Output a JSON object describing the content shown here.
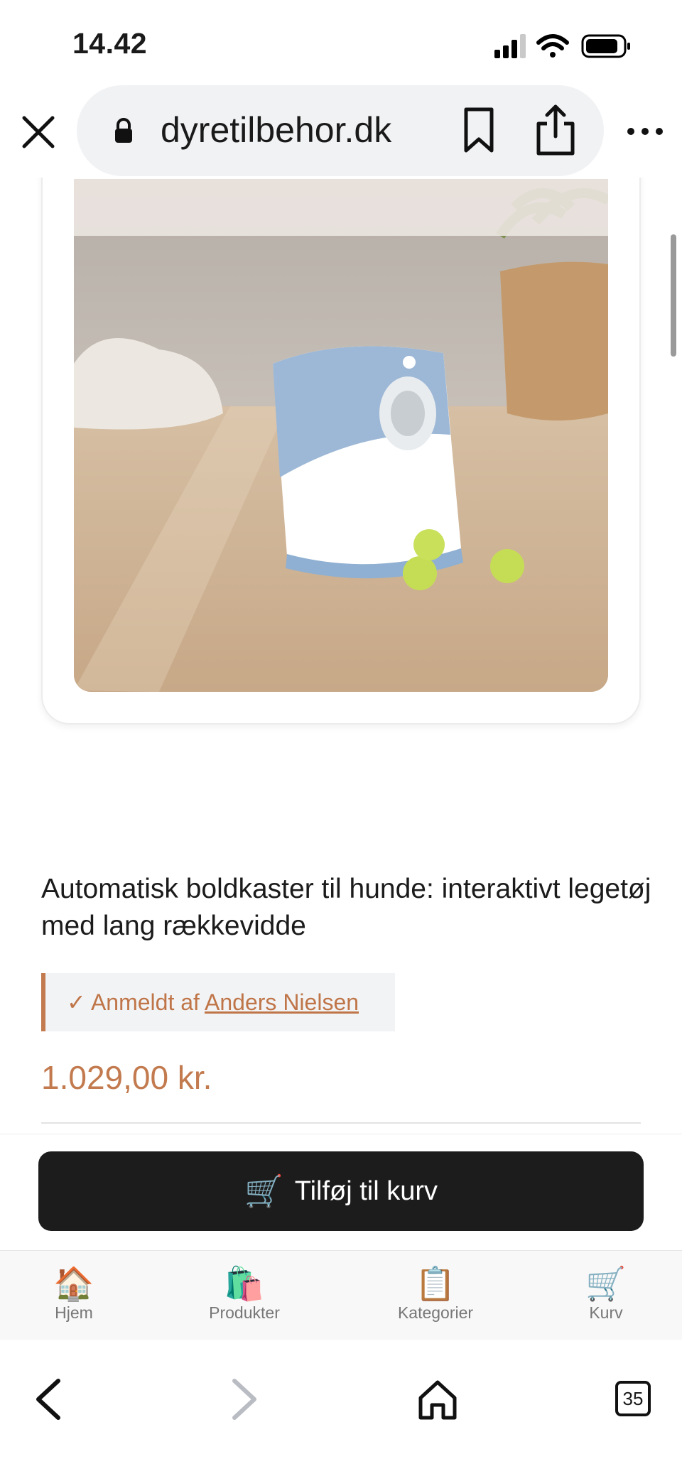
{
  "status_bar": {
    "time": "14.42"
  },
  "browser": {
    "url": "dyretilbehor.dk",
    "tabs_count": "35"
  },
  "product": {
    "image_alt": "Automatisk boldkaster produktbillede",
    "title": "Automatisk boldkaster til hunde: interaktivt legetøj med lang rækkevidde",
    "review_prefix": "✓ Anmeldt af ",
    "reviewer": "Anders Nielsen",
    "price": "1.029,00 kr."
  },
  "cart": {
    "add_label": "Tilføj til kurv",
    "icon": "🛒"
  },
  "bottom_nav": {
    "items": [
      {
        "label": "Hjem",
        "icon": "🏠"
      },
      {
        "label": "Produkter",
        "icon": "🛍️"
      },
      {
        "label": "Kategorier",
        "icon": "📋"
      },
      {
        "label": "Kurv",
        "icon": "🛒"
      }
    ]
  },
  "colors": {
    "accent": "#c27a4e",
    "button_bg": "#1c1c1c",
    "review_bg": "#f2f3f5"
  }
}
